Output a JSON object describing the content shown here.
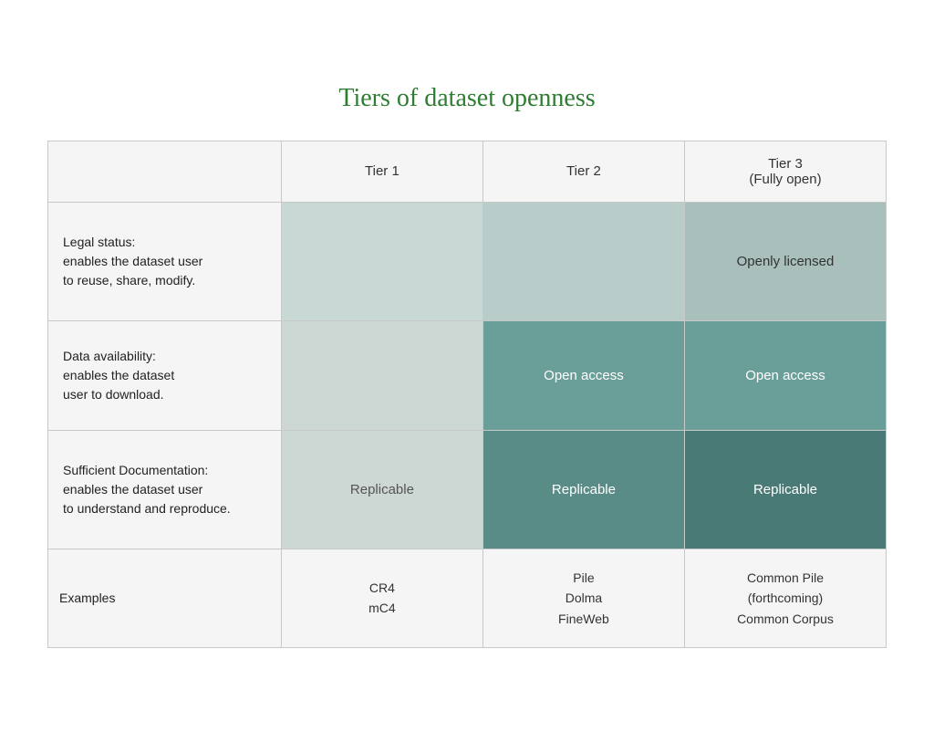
{
  "title": "Tiers of dataset openness",
  "header": {
    "label_col": "",
    "tier1": "Tier 1",
    "tier2": "Tier 2",
    "tier3_line1": "Tier 3",
    "tier3_line2": "(Fully open)"
  },
  "rows": {
    "legal": {
      "label_line1": "Legal status:",
      "label_line2": "enables the dataset user",
      "label_line3": "to reuse, share, modify.",
      "tier1": "",
      "tier2": "",
      "tier3": "Openly licensed"
    },
    "availability": {
      "label_line1": "Data availability:",
      "label_line2": "enables the dataset",
      "label_line3": "user to download.",
      "tier1": "",
      "tier2": "Open access",
      "tier3": "Open access"
    },
    "documentation": {
      "label_line1": "Sufficient Documentation:",
      "label_line2": "enables the dataset user",
      "label_line3": "to understand and reproduce.",
      "tier1": "Replicable",
      "tier2": "Replicable",
      "tier3": "Replicable"
    },
    "examples": {
      "label": "Examples",
      "tier1_line1": "CR4",
      "tier1_line2": "mC4",
      "tier2_line1": "Pile",
      "tier2_line2": "Dolma",
      "tier2_line3": "FineWeb",
      "tier3_line1": "Common Pile",
      "tier3_line2": "(forthcoming)",
      "tier3_line3": "Common Corpus"
    }
  }
}
